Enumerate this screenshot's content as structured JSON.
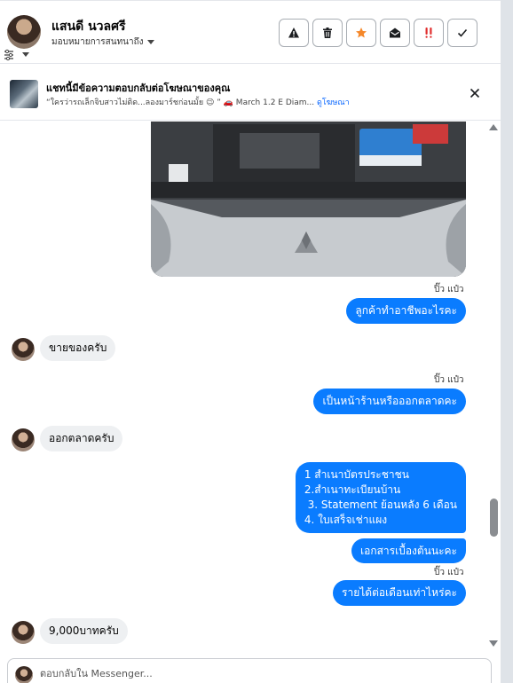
{
  "header": {
    "contact_name": "แสนดี นวลศรี",
    "assign_label": "มอบหมายการสนทนาถึง",
    "actions": [
      {
        "name": "report-button",
        "icon": "warning-triangle-icon",
        "color": "#1c1e21"
      },
      {
        "name": "delete-button",
        "icon": "trash-icon",
        "color": "#1c1e21"
      },
      {
        "name": "star-button",
        "icon": "star-icon",
        "color": "#f5882a"
      },
      {
        "name": "mark-unread-button",
        "icon": "envelope-open-icon",
        "color": "#1c1e21"
      },
      {
        "name": "spam-button",
        "icon": "exclamation-double-icon",
        "color": "#e02d2d"
      },
      {
        "name": "done-button",
        "icon": "checkmark-icon",
        "color": "#1c1e21"
      }
    ]
  },
  "ad_banner": {
    "title": "แชทนี้มีข้อความตอบกลับต่อโฆษณาของคุณ",
    "subtitle": "“ใครว่ารถเล็กจิบสาวไม่ติด...ลองมาร์ชก่อนมั้ย 😉 ” 🚗 March 1.2 E Diam...",
    "link": "ดูโฆษณา"
  },
  "messages": {
    "seen_label": "ปิ๊ว แป๋ว",
    "out_1": "ลูกค้าทำอาชีพอะไรคะ",
    "in_1": "ขายของครับ",
    "out_2": "เป็นหน้าร้านหรือออกตลาดคะ",
    "in_2": "ออกตลาดครับ",
    "out_3_lines": [
      "1 สำเนาบัตรประชาชน",
      "2.สำเนาทะเบียนบ้าน",
      " 3. Statement ย้อนหลัง 6 เดือน",
      "4. ใบเสร็จเช่าแผง"
    ],
    "out_4": "เอกสารเบื้องต้นนะคะ",
    "out_5": "รายได้ต่อเดือนเท่าไหร่คะ",
    "in_3": "9,000บาทครับ"
  },
  "reply_box": {
    "placeholder": "ตอบกลับใน Messenger..."
  },
  "colors": {
    "outgoing_bubble": "#0a7cff",
    "incoming_bubble": "#eef0f2",
    "link": "#0866ff"
  }
}
